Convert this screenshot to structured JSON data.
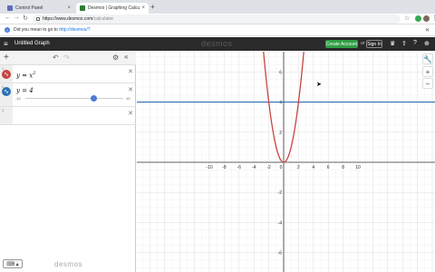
{
  "browser": {
    "tabs": [
      {
        "label": "Control Panel",
        "active": false,
        "color": "#5c6bc0"
      },
      {
        "label": "Desmos | Graphing Calculato",
        "active": true,
        "color": "#2e7d32"
      }
    ],
    "new_tab": "+",
    "url_host": "https://www.desmos.com",
    "url_path": "/calculator",
    "infobar_text": "Did you mean to go to",
    "infobar_link": "http://desmos/?"
  },
  "header": {
    "title": "Untitled Graph",
    "brand": "desmos",
    "create_account": "Create Account",
    "or": "or",
    "sign_in": "Sign In"
  },
  "expressions": [
    {
      "index": "1",
      "latex_main": "y = x",
      "latex_sup": "2",
      "color": "#c74440"
    },
    {
      "index": "2",
      "latex_main": "y = 4",
      "latex_sup": "",
      "color": "#2d70b3",
      "slider_min": "-10",
      "slider_max": "10",
      "slider_value": 4
    },
    {
      "index": "3",
      "latex_main": "",
      "latex_sup": ""
    }
  ],
  "footer": {
    "brand": "desmos",
    "keyboard": "⌨ ▴"
  },
  "graph": {
    "x_ticks": [
      "-10",
      "-8",
      "-6",
      "-4",
      "-2",
      "0",
      "2",
      "4",
      "6",
      "8",
      "10"
    ],
    "y_ticks": [
      "6",
      "4",
      "2",
      "-2",
      "-4",
      "-6"
    ],
    "xlim": [
      -10,
      10
    ],
    "ylim": [
      -7,
      7.5
    ],
    "functions": [
      {
        "expression": "y=x^2",
        "color": "#c74440"
      },
      {
        "expression": "y=4",
        "color": "#2d70b3"
      }
    ]
  }
}
